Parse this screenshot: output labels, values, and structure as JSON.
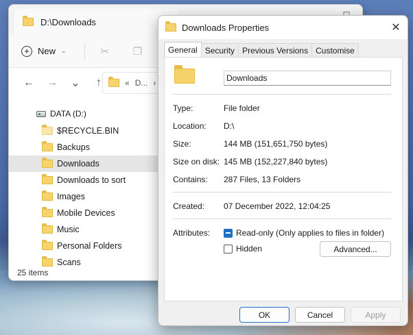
{
  "explorer": {
    "tab_title": "D:\\Downloads",
    "toolbar": {
      "new_label": "New"
    },
    "address": {
      "ellipsis": "«",
      "crumb": "D..."
    },
    "drive_label": "DATA (D:)",
    "folders": [
      "$RECYCLE.BIN",
      "Backups",
      "Downloads",
      "Downloads to sort",
      "Images",
      "Mobile Devices",
      "Music",
      "Personal Folders",
      "Scans"
    ],
    "status": "25 items"
  },
  "dialog": {
    "title": "Downloads Properties",
    "tabs": [
      "General",
      "Security",
      "Previous Versions",
      "Customise"
    ],
    "active_tab": "General",
    "name_value": "Downloads",
    "properties": {
      "type_label": "Type:",
      "type_value": "File folder",
      "location_label": "Location:",
      "location_value": "D:\\",
      "size_label": "Size:",
      "size_value": "144 MB (151,651,750 bytes)",
      "size_on_disk_label": "Size on disk:",
      "size_on_disk_value": "145 MB (152,227,840 bytes)",
      "contains_label": "Contains:",
      "contains_value": "287 Files, 13 Folders",
      "created_label": "Created:",
      "created_value": "07 December 2022, 12:04:25"
    },
    "attributes_label": "Attributes:",
    "readonly_label": "Read-only (Only applies to files in folder)",
    "hidden_label": "Hidden",
    "advanced_label": "Advanced...",
    "ok_label": "OK",
    "cancel_label": "Cancel",
    "apply_label": "Apply"
  }
}
